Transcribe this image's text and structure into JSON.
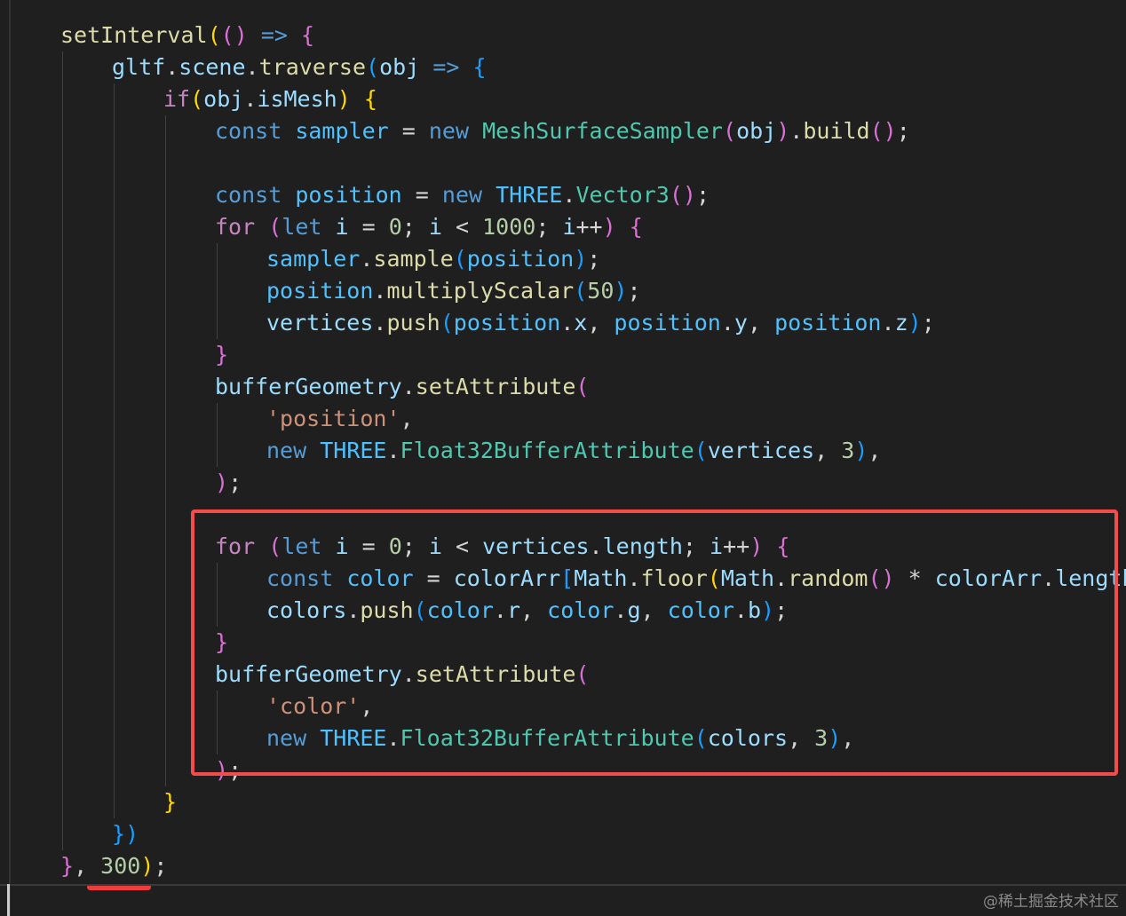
{
  "code_lines": [
    {
      "tokens": [
        {
          "t": "setInterval",
          "c": "fn"
        },
        {
          "t": "(",
          "c": "b1"
        },
        {
          "t": "(",
          "c": "b2"
        },
        {
          "t": ")",
          "c": "b2"
        },
        {
          "t": " ",
          "c": "punc"
        },
        {
          "t": "=>",
          "c": "kw"
        },
        {
          "t": " ",
          "c": "punc"
        },
        {
          "t": "{",
          "c": "b2"
        }
      ]
    },
    {
      "tokens": [
        {
          "t": "gltf",
          "c": "var"
        },
        {
          "t": ".",
          "c": "punc"
        },
        {
          "t": "scene",
          "c": "var"
        },
        {
          "t": ".",
          "c": "punc"
        },
        {
          "t": "traverse",
          "c": "fn"
        },
        {
          "t": "(",
          "c": "b3"
        },
        {
          "t": "obj",
          "c": "var"
        },
        {
          "t": " ",
          "c": "punc"
        },
        {
          "t": "=>",
          "c": "kw"
        },
        {
          "t": " ",
          "c": "punc"
        },
        {
          "t": "{",
          "c": "b3"
        }
      ]
    },
    {
      "tokens": [
        {
          "t": "if",
          "c": "ctrl"
        },
        {
          "t": "(",
          "c": "b1"
        },
        {
          "t": "obj",
          "c": "var"
        },
        {
          "t": ".",
          "c": "punc"
        },
        {
          "t": "isMesh",
          "c": "var"
        },
        {
          "t": ")",
          "c": "b1"
        },
        {
          "t": " ",
          "c": "punc"
        },
        {
          "t": "{",
          "c": "b1"
        }
      ]
    },
    {
      "tokens": [
        {
          "t": "const",
          "c": "kw"
        },
        {
          "t": " ",
          "c": "punc"
        },
        {
          "t": "sampler",
          "c": "const"
        },
        {
          "t": " = ",
          "c": "op"
        },
        {
          "t": "new",
          "c": "kw"
        },
        {
          "t": " ",
          "c": "punc"
        },
        {
          "t": "MeshSurfaceSampler",
          "c": "cls"
        },
        {
          "t": "(",
          "c": "b2"
        },
        {
          "t": "obj",
          "c": "var"
        },
        {
          "t": ")",
          "c": "b2"
        },
        {
          "t": ".",
          "c": "punc"
        },
        {
          "t": "build",
          "c": "fn"
        },
        {
          "t": "(",
          "c": "b2"
        },
        {
          "t": ")",
          "c": "b2"
        },
        {
          "t": ";",
          "c": "punc"
        }
      ]
    },
    {
      "tokens": []
    },
    {
      "tokens": [
        {
          "t": "const",
          "c": "kw"
        },
        {
          "t": " ",
          "c": "punc"
        },
        {
          "t": "position",
          "c": "const"
        },
        {
          "t": " = ",
          "c": "op"
        },
        {
          "t": "new",
          "c": "kw"
        },
        {
          "t": " ",
          "c": "punc"
        },
        {
          "t": "THREE",
          "c": "const"
        },
        {
          "t": ".",
          "c": "punc"
        },
        {
          "t": "Vector3",
          "c": "cls"
        },
        {
          "t": "(",
          "c": "b2"
        },
        {
          "t": ")",
          "c": "b2"
        },
        {
          "t": ";",
          "c": "punc"
        }
      ]
    },
    {
      "tokens": [
        {
          "t": "for",
          "c": "ctrl"
        },
        {
          "t": " ",
          "c": "punc"
        },
        {
          "t": "(",
          "c": "b2"
        },
        {
          "t": "let",
          "c": "kw"
        },
        {
          "t": " ",
          "c": "punc"
        },
        {
          "t": "i",
          "c": "var"
        },
        {
          "t": " = ",
          "c": "op"
        },
        {
          "t": "0",
          "c": "num"
        },
        {
          "t": "; ",
          "c": "punc"
        },
        {
          "t": "i",
          "c": "var"
        },
        {
          "t": " < ",
          "c": "op"
        },
        {
          "t": "1000",
          "c": "num"
        },
        {
          "t": "; ",
          "c": "punc"
        },
        {
          "t": "i",
          "c": "var"
        },
        {
          "t": "++",
          "c": "op"
        },
        {
          "t": ")",
          "c": "b2"
        },
        {
          "t": " ",
          "c": "punc"
        },
        {
          "t": "{",
          "c": "b2"
        }
      ]
    },
    {
      "tokens": [
        {
          "t": "sampler",
          "c": "const"
        },
        {
          "t": ".",
          "c": "punc"
        },
        {
          "t": "sample",
          "c": "fn"
        },
        {
          "t": "(",
          "c": "b3"
        },
        {
          "t": "position",
          "c": "const"
        },
        {
          "t": ")",
          "c": "b3"
        },
        {
          "t": ";",
          "c": "punc"
        }
      ]
    },
    {
      "tokens": [
        {
          "t": "position",
          "c": "const"
        },
        {
          "t": ".",
          "c": "punc"
        },
        {
          "t": "multiplyScalar",
          "c": "fn"
        },
        {
          "t": "(",
          "c": "b3"
        },
        {
          "t": "50",
          "c": "num"
        },
        {
          "t": ")",
          "c": "b3"
        },
        {
          "t": ";",
          "c": "punc"
        }
      ]
    },
    {
      "tokens": [
        {
          "t": "vertices",
          "c": "var"
        },
        {
          "t": ".",
          "c": "punc"
        },
        {
          "t": "push",
          "c": "fn"
        },
        {
          "t": "(",
          "c": "b3"
        },
        {
          "t": "position",
          "c": "const"
        },
        {
          "t": ".",
          "c": "punc"
        },
        {
          "t": "x",
          "c": "var"
        },
        {
          "t": ", ",
          "c": "punc"
        },
        {
          "t": "position",
          "c": "const"
        },
        {
          "t": ".",
          "c": "punc"
        },
        {
          "t": "y",
          "c": "var"
        },
        {
          "t": ", ",
          "c": "punc"
        },
        {
          "t": "position",
          "c": "const"
        },
        {
          "t": ".",
          "c": "punc"
        },
        {
          "t": "z",
          "c": "var"
        },
        {
          "t": ")",
          "c": "b3"
        },
        {
          "t": ";",
          "c": "punc"
        }
      ]
    },
    {
      "tokens": [
        {
          "t": "}",
          "c": "b2"
        }
      ]
    },
    {
      "tokens": [
        {
          "t": "bufferGeometry",
          "c": "var"
        },
        {
          "t": ".",
          "c": "punc"
        },
        {
          "t": "setAttribute",
          "c": "fn"
        },
        {
          "t": "(",
          "c": "b2"
        }
      ]
    },
    {
      "tokens": [
        {
          "t": "'position'",
          "c": "str"
        },
        {
          "t": ",",
          "c": "punc"
        }
      ]
    },
    {
      "tokens": [
        {
          "t": "new",
          "c": "kw"
        },
        {
          "t": " ",
          "c": "punc"
        },
        {
          "t": "THREE",
          "c": "const"
        },
        {
          "t": ".",
          "c": "punc"
        },
        {
          "t": "Float32BufferAttribute",
          "c": "cls"
        },
        {
          "t": "(",
          "c": "b3"
        },
        {
          "t": "vertices",
          "c": "var"
        },
        {
          "t": ", ",
          "c": "punc"
        },
        {
          "t": "3",
          "c": "num"
        },
        {
          "t": ")",
          "c": "b3"
        },
        {
          "t": ",",
          "c": "punc"
        }
      ]
    },
    {
      "tokens": [
        {
          "t": ")",
          "c": "b2"
        },
        {
          "t": ";",
          "c": "punc"
        }
      ]
    },
    {
      "tokens": []
    },
    {
      "tokens": [
        {
          "t": "for",
          "c": "ctrl"
        },
        {
          "t": " ",
          "c": "punc"
        },
        {
          "t": "(",
          "c": "b2"
        },
        {
          "t": "let",
          "c": "kw"
        },
        {
          "t": " ",
          "c": "punc"
        },
        {
          "t": "i",
          "c": "var"
        },
        {
          "t": " = ",
          "c": "op"
        },
        {
          "t": "0",
          "c": "num"
        },
        {
          "t": "; ",
          "c": "punc"
        },
        {
          "t": "i",
          "c": "var"
        },
        {
          "t": " < ",
          "c": "op"
        },
        {
          "t": "vertices",
          "c": "var"
        },
        {
          "t": ".",
          "c": "punc"
        },
        {
          "t": "length",
          "c": "var"
        },
        {
          "t": "; ",
          "c": "punc"
        },
        {
          "t": "i",
          "c": "var"
        },
        {
          "t": "++",
          "c": "op"
        },
        {
          "t": ")",
          "c": "b2"
        },
        {
          "t": " ",
          "c": "punc"
        },
        {
          "t": "{",
          "c": "b2"
        }
      ]
    },
    {
      "tokens": [
        {
          "t": "const",
          "c": "kw"
        },
        {
          "t": " ",
          "c": "punc"
        },
        {
          "t": "color",
          "c": "const"
        },
        {
          "t": " = ",
          "c": "op"
        },
        {
          "t": "colorArr",
          "c": "var"
        },
        {
          "t": "[",
          "c": "b3"
        },
        {
          "t": "Math",
          "c": "var"
        },
        {
          "t": ".",
          "c": "punc"
        },
        {
          "t": "floor",
          "c": "fn"
        },
        {
          "t": "(",
          "c": "b1"
        },
        {
          "t": "Math",
          "c": "var"
        },
        {
          "t": ".",
          "c": "punc"
        },
        {
          "t": "random",
          "c": "fn"
        },
        {
          "t": "(",
          "c": "b2"
        },
        {
          "t": ")",
          "c": "b2"
        },
        {
          "t": " * ",
          "c": "op"
        },
        {
          "t": "colorArr",
          "c": "var"
        },
        {
          "t": ".",
          "c": "punc"
        },
        {
          "t": "length",
          "c": "var"
        },
        {
          "t": ")",
          "c": "b1"
        },
        {
          "t": "]",
          "c": "b3"
        }
      ]
    },
    {
      "tokens": [
        {
          "t": "colors",
          "c": "var"
        },
        {
          "t": ".",
          "c": "punc"
        },
        {
          "t": "push",
          "c": "fn"
        },
        {
          "t": "(",
          "c": "b3"
        },
        {
          "t": "color",
          "c": "const"
        },
        {
          "t": ".",
          "c": "punc"
        },
        {
          "t": "r",
          "c": "var"
        },
        {
          "t": ", ",
          "c": "punc"
        },
        {
          "t": "color",
          "c": "const"
        },
        {
          "t": ".",
          "c": "punc"
        },
        {
          "t": "g",
          "c": "var"
        },
        {
          "t": ", ",
          "c": "punc"
        },
        {
          "t": "color",
          "c": "const"
        },
        {
          "t": ".",
          "c": "punc"
        },
        {
          "t": "b",
          "c": "var"
        },
        {
          "t": ")",
          "c": "b3"
        },
        {
          "t": ";",
          "c": "punc"
        }
      ]
    },
    {
      "tokens": [
        {
          "t": "}",
          "c": "b2"
        }
      ]
    },
    {
      "tokens": [
        {
          "t": "bufferGeometry",
          "c": "var"
        },
        {
          "t": ".",
          "c": "punc"
        },
        {
          "t": "setAttribute",
          "c": "fn"
        },
        {
          "t": "(",
          "c": "b2"
        }
      ]
    },
    {
      "tokens": [
        {
          "t": "'color'",
          "c": "str"
        },
        {
          "t": ",",
          "c": "punc"
        }
      ]
    },
    {
      "tokens": [
        {
          "t": "new",
          "c": "kw"
        },
        {
          "t": " ",
          "c": "punc"
        },
        {
          "t": "THREE",
          "c": "const"
        },
        {
          "t": ".",
          "c": "punc"
        },
        {
          "t": "Float32BufferAttribute",
          "c": "cls"
        },
        {
          "t": "(",
          "c": "b3"
        },
        {
          "t": "colors",
          "c": "var"
        },
        {
          "t": ", ",
          "c": "punc"
        },
        {
          "t": "3",
          "c": "num"
        },
        {
          "t": ")",
          "c": "b3"
        },
        {
          "t": ",",
          "c": "punc"
        }
      ]
    },
    {
      "tokens": [
        {
          "t": ")",
          "c": "b2"
        },
        {
          "t": ";",
          "c": "punc"
        }
      ]
    },
    {
      "tokens": [
        {
          "t": "}",
          "c": "b1"
        }
      ]
    },
    {
      "tokens": [
        {
          "t": "}",
          "c": "b3"
        },
        {
          "t": ")",
          "c": "b3"
        }
      ]
    },
    {
      "tokens": [
        {
          "t": "}",
          "c": "b2"
        },
        {
          "t": ", ",
          "c": "punc"
        },
        {
          "t": "300",
          "c": "num"
        },
        {
          "t": ")",
          "c": "b1"
        },
        {
          "t": ";",
          "c": "punc"
        }
      ]
    }
  ],
  "watermark": "@稀土掘金技术社区",
  "colors": {
    "background": "#1f1f1f",
    "highlight_box": "#f44b4b",
    "underline_mark": "#f03c3c"
  }
}
